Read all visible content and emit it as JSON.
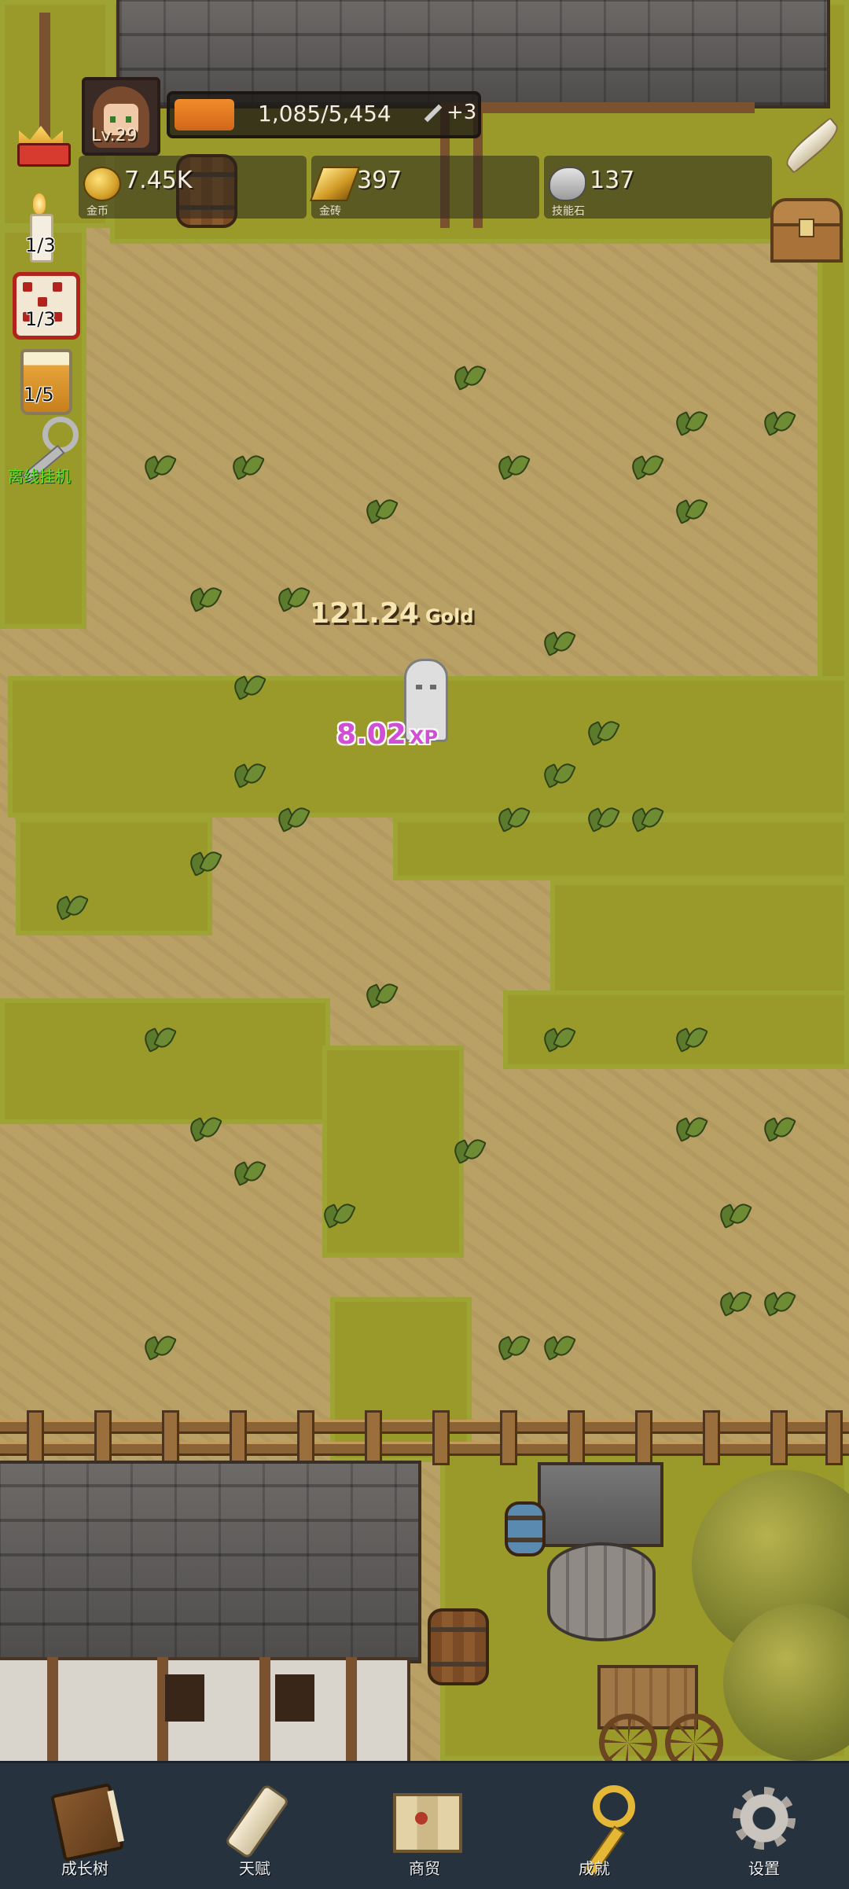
{
  "player": {
    "level_label": "Lv.29",
    "xp_text": "1,085/5,454",
    "xp_progress": 0.2,
    "key_bonus": "+3"
  },
  "resources": [
    {
      "icon": "gold-coin-icon",
      "value": "7.45K",
      "label": "金币"
    },
    {
      "icon": "gold-bar-icon",
      "value": "397",
      "label": "金砖"
    },
    {
      "icon": "skill-stone-icon",
      "value": "137",
      "label": "技能石"
    }
  ],
  "side_items": {
    "candle_count": "1/3",
    "dice_count": "1/3",
    "beer_count": "1/5",
    "idle_label": "离线挂机"
  },
  "floating": {
    "gold_value": "121.24",
    "gold_unit": "Gold",
    "xp_value": "8.02",
    "xp_unit": "XP"
  },
  "nav": [
    {
      "icon": "book-icon",
      "label": "成长树"
    },
    {
      "icon": "scroll-icon",
      "label": "天赋"
    },
    {
      "icon": "map-icon",
      "label": "商贸"
    },
    {
      "icon": "golden-key-icon",
      "label": "成就"
    },
    {
      "icon": "gear-icon",
      "label": "设置"
    }
  ],
  "colors": {
    "ground": "#b9a065",
    "grass": "#9a9a2a",
    "xp_fill": "#f08c2a",
    "nav_bg": "#27323f",
    "xp_float": "#d04fd4",
    "idle_text": "#5ce628"
  }
}
